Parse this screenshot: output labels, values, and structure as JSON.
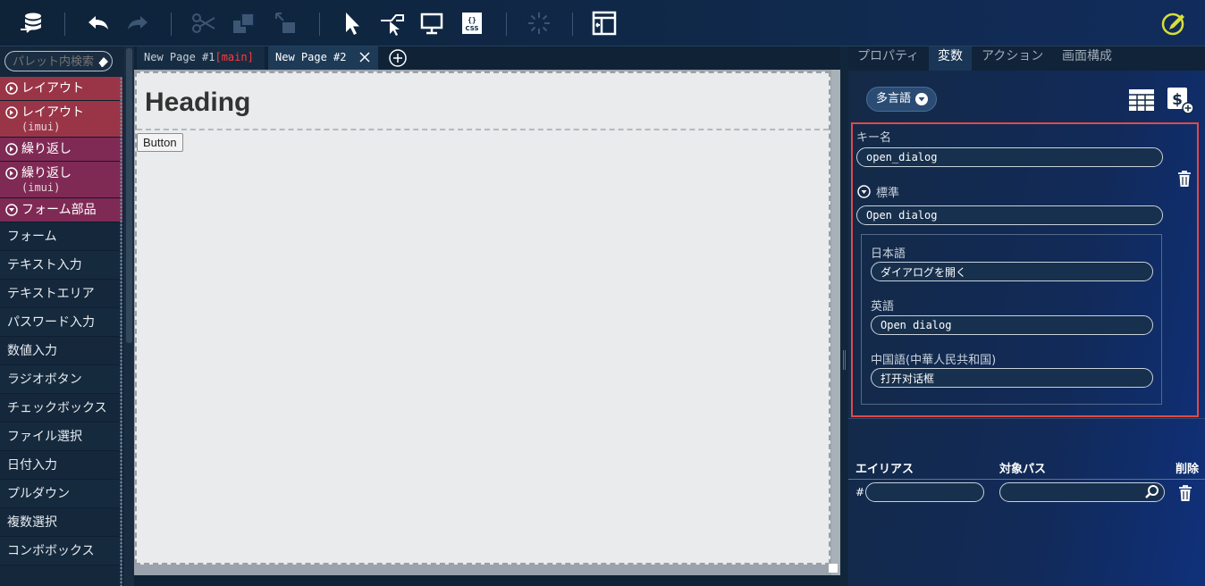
{
  "palette": {
    "search_placeholder": "パレット内検索",
    "categories": [
      {
        "label": "レイアウト",
        "sub": ""
      },
      {
        "label": "レイアウト",
        "sub": "(imui)"
      },
      {
        "label": "繰り返し",
        "sub": ""
      },
      {
        "label": "繰り返し",
        "sub": "(imui)"
      },
      {
        "label": "フォーム部品",
        "sub": ""
      }
    ],
    "items": [
      "フォーム",
      "テキスト入力",
      "テキストエリア",
      "パスワード入力",
      "数値入力",
      "ラジオボタン",
      "チェックボックス",
      "ファイル選択",
      "日付入力",
      "プルダウン",
      "複数選択",
      "コンボボックス"
    ]
  },
  "tabs": {
    "tab1_label": "New Page #1",
    "tab1_badge": "[main]",
    "tab2_label": "New Page #2"
  },
  "canvas": {
    "heading": "Heading",
    "button": "Button"
  },
  "right_panel": {
    "tabs": [
      "プロパティ",
      "変数",
      "アクション",
      "画面構成"
    ],
    "active_tab": "変数",
    "lang_button": "多言語",
    "key_label": "キー名",
    "key_value": "open_dialog",
    "standard_label": "標準",
    "standard_value": "Open dialog",
    "languages": [
      {
        "label": "日本語",
        "value": "ダイアログを開く"
      },
      {
        "label": "英語",
        "value": "Open dialog"
      },
      {
        "label": "中国語(中華人民共和国)",
        "value": "打开对话框"
      }
    ],
    "alias_header": "エイリアス",
    "target_path_header": "対象パス",
    "delete_header": "削除",
    "hash": "#",
    "alias_value": "",
    "path_value": ""
  },
  "colors": {
    "accent_red": "#e04a48",
    "layout_category": "#9a3548",
    "repeat_category": "#7f2a55",
    "main_badge": "#ff3b3b",
    "edit_icon": "#d6e03a"
  }
}
